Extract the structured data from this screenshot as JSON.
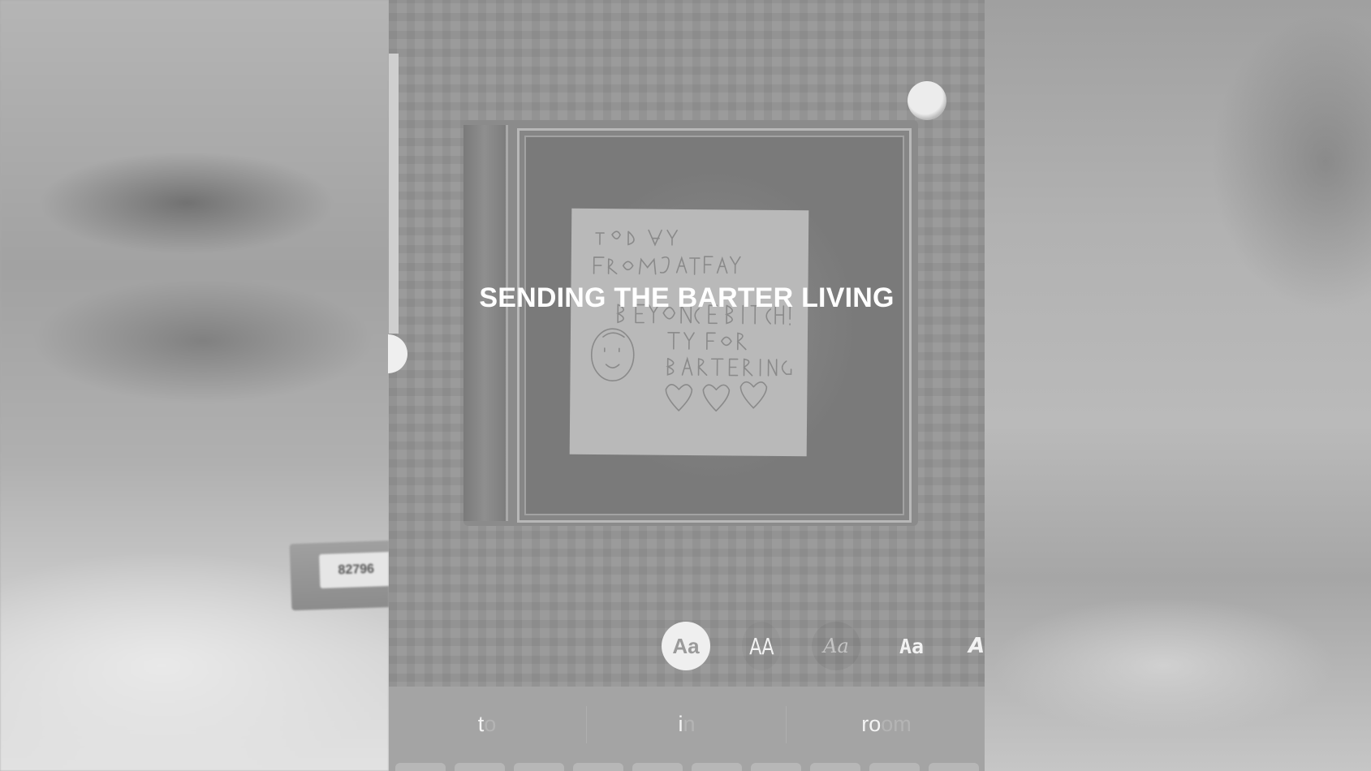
{
  "background": {
    "cassette_label": "82796"
  },
  "story": {
    "headline": "SENDING THE BARTER LIVING"
  },
  "font_picker": {
    "options": [
      {
        "label": "Aa",
        "selected": true
      },
      {
        "label": "AA",
        "selected": false
      },
      {
        "label": "Aa",
        "selected": false
      },
      {
        "label": "Aa",
        "selected": false
      },
      {
        "label": "A",
        "selected": false
      }
    ]
  },
  "keyboard": {
    "suggestions": [
      {
        "typed": "t",
        "rest": "o"
      },
      {
        "typed": "i",
        "rest": "n"
      },
      {
        "typed": "ro",
        "rest": "om"
      }
    ],
    "visible_key_count": 10
  },
  "colors": {
    "headline": "#ffffff",
    "selected_font_bg": "#efefef",
    "overlay_gray": "#9b9b9b"
  }
}
